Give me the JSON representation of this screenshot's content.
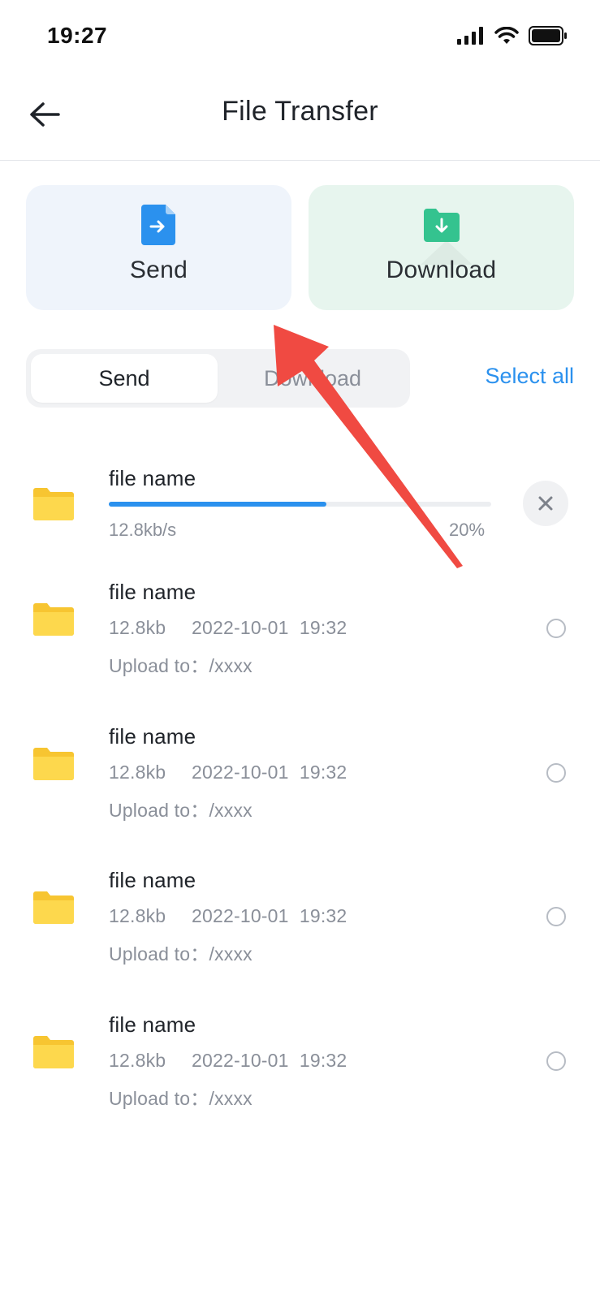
{
  "status_bar": {
    "time": "19:27",
    "icons": [
      "signal-icon",
      "wifi-icon",
      "battery-icon"
    ]
  },
  "nav": {
    "title": "File Transfer",
    "back_icon": "back-arrow-icon"
  },
  "cards": [
    {
      "label": "Send",
      "icon": "file-send-icon",
      "color": "#2b91ee"
    },
    {
      "label": "Download",
      "icon": "folder-download-icon",
      "color": "#34c38f"
    }
  ],
  "segment": {
    "tabs": [
      "Send",
      "Download"
    ],
    "active": "Send"
  },
  "select_all": "Select all",
  "active_transfer": {
    "name": "file name",
    "speed": "12.8kb/s",
    "progress_label": "20%",
    "progress": 0.57
  },
  "files": [
    {
      "name": "file name",
      "size": "12.8kb",
      "datetime": "2022-10-01  19:32",
      "dest": "Upload to：/xxxx"
    },
    {
      "name": "file name",
      "size": "12.8kb",
      "datetime": "2022-10-01  19:32",
      "dest": "Upload to：/xxxx"
    },
    {
      "name": "file name",
      "size": "12.8kb",
      "datetime": "2022-10-01  19:32",
      "dest": "Upload to：/xxxx"
    },
    {
      "name": "file name",
      "size": "12.8kb",
      "datetime": "2022-10-01  19:32",
      "dest": "Upload to：/xxxx"
    }
  ],
  "colors": {
    "accent": "#2b91ee",
    "annotation_arrow": "#f04a42",
    "folder": "#fcd23f"
  }
}
